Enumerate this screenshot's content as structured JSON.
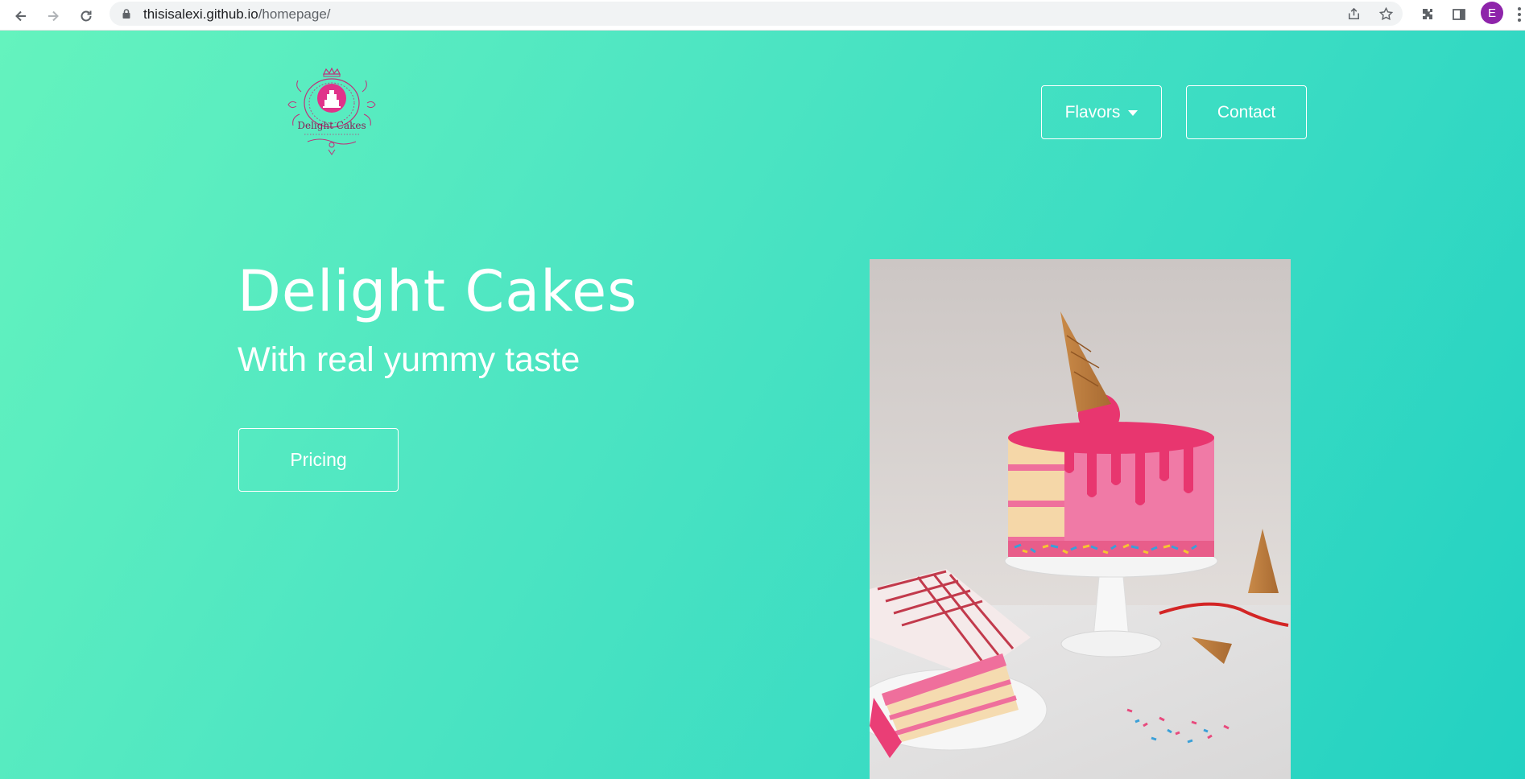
{
  "browser": {
    "url_host": "thisisalexi.github.io",
    "url_path": "/homepage/",
    "profile_initial": "E",
    "icons": [
      "back-icon",
      "forward-icon",
      "reload-icon",
      "lock-icon",
      "share-icon",
      "star-icon",
      "extensions-icon",
      "side-panel-icon",
      "menu-icon"
    ]
  },
  "header": {
    "logo_text": "Delight Cakes",
    "flavors_label": "Flavors",
    "contact_label": "Contact"
  },
  "hero": {
    "title": "Delight Cakes",
    "subtitle": "With real yummy taste",
    "pricing_label": "Pricing",
    "image_subject": "pink drip cake with ice cream cone on a cake stand"
  },
  "colors": {
    "gradient_start": "#64f3be",
    "gradient_end": "#23d1c2",
    "logo_pink": "#e0338a",
    "text": "#ffffff"
  }
}
